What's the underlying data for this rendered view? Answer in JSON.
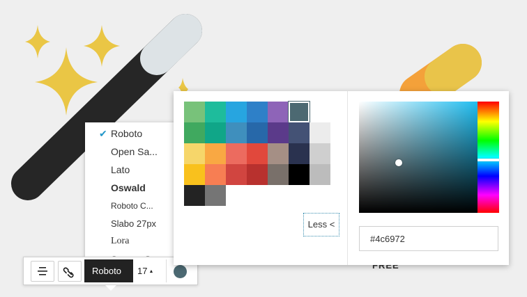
{
  "font_menu": {
    "items": [
      {
        "label": "Roboto",
        "checked": true
      },
      {
        "label": "Open Sa...",
        "checked": false
      },
      {
        "label": "Lato",
        "checked": false
      },
      {
        "label": "Oswald",
        "checked": false
      },
      {
        "label": "Roboto C...",
        "checked": false
      },
      {
        "label": "Slabo 27px",
        "checked": false
      },
      {
        "label": "Lora",
        "checked": false
      },
      {
        "label": "Source S...",
        "checked": false
      }
    ],
    "check_glyph": "✔"
  },
  "toolbar": {
    "font_label": "Roboto",
    "size_label": "17",
    "size_caret": "▲",
    "color": "#4c6972"
  },
  "color_picker": {
    "swatches": [
      [
        "#78c27a",
        "#1ebc9c",
        "#27a5e0",
        "#2e80c8",
        "#8e64b8",
        "#4c6972"
      ],
      [
        "#40a95f",
        "#10a688",
        "#3f8fbd",
        "#2768a9",
        "#5b3a8a",
        "#445275",
        "#ececec"
      ],
      [
        "#f6d66a",
        "#f9a843",
        "#ec6b5f",
        "#e1483c",
        "#a58f85",
        "#2a324f",
        "#cfcfcf"
      ],
      [
        "#f9c11d",
        "#f77e53",
        "#d14540",
        "#b8312e",
        "#79706a",
        "#000000",
        "#bcbcbc"
      ],
      [
        "#232323",
        "#757575"
      ]
    ],
    "selected_color": "#4c6972",
    "less_label": "Less <",
    "hex_value": "#4c6972"
  },
  "background": {
    "free_label": "FREE"
  }
}
